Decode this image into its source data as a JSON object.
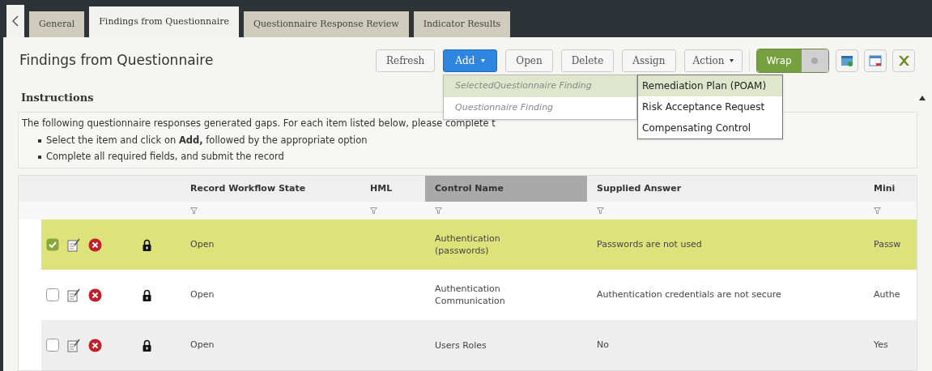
{
  "tabs": [
    {
      "label": "General",
      "selected": false
    },
    {
      "label": "Findings from Questionnaire",
      "selected": true
    },
    {
      "label": "Questionnaire Response Review",
      "selected": false
    },
    {
      "label": "Indicator Results",
      "selected": false
    }
  ],
  "title": "Findings from Questionnaire",
  "toolbar": [
    {
      "label": "Refresh",
      "kind": "plain"
    },
    {
      "label": "Add",
      "kind": "primary-menu"
    },
    {
      "label": "Open",
      "kind": "plain"
    },
    {
      "label": "Delete",
      "kind": "plain"
    },
    {
      "label": "Assign",
      "kind": "plain"
    },
    {
      "label": "Action",
      "kind": "menu"
    }
  ],
  "wrap_toggle": {
    "label": "Wrap",
    "on": true
  },
  "add_menu": [
    {
      "label": "SelectedQuestionnaire Finding",
      "selected": true
    },
    {
      "label": "Questionnaire Finding",
      "selected": false
    }
  ],
  "submenu": [
    {
      "label": "Remediation Plan (POAM)",
      "selected": true
    },
    {
      "label": "Risk Acceptance Request",
      "selected": false
    },
    {
      "label": "Compensating Control",
      "selected": false
    }
  ],
  "instructions": {
    "heading": "Instructions",
    "expanded": true,
    "text": "The following questionnaire responses generated gaps. For each item listed below,  please complete t",
    "bullets": [
      "Select the item and click on **Add,** followed by the appropriate option",
      "Complete all required fields, and submit the record"
    ]
  },
  "table": {
    "columns": [
      {
        "label": "Record Workflow State",
        "sorted": false
      },
      {
        "label": "HML",
        "sorted": false
      },
      {
        "label": "Control Name",
        "sorted": true
      },
      {
        "label": "Supplied Answer",
        "sorted": false
      },
      {
        "label": "Mini",
        "sorted": false
      }
    ],
    "rows": [
      {
        "checked": true,
        "cells": [
          "Open",
          "",
          "Authentication (passwords)",
          "Passwords are not used",
          "Passw"
        ]
      },
      {
        "checked": false,
        "cells": [
          "Open",
          "",
          "Authentication Communication",
          "Authentication credentials are not secure",
          "Authe"
        ]
      },
      {
        "checked": false,
        "cells": [
          "Open",
          "",
          "Users Roles",
          "No",
          "Yes"
        ]
      }
    ]
  }
}
